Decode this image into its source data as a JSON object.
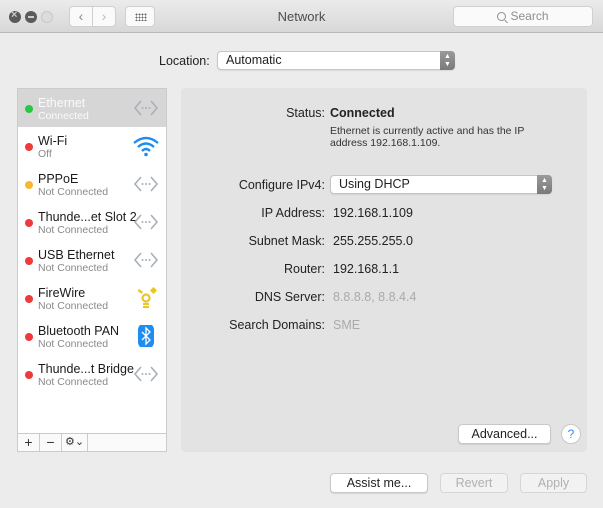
{
  "window": {
    "title": "Network",
    "search_placeholder": "Search",
    "back_glyph": "‹",
    "forward_glyph": "›"
  },
  "location": {
    "label": "Location:",
    "value": "Automatic"
  },
  "services": [
    {
      "name": "Ethernet",
      "status": "Connected",
      "dot_color": "#28c840",
      "icon": "ethernet-icon",
      "selected": true
    },
    {
      "name": "Wi-Fi",
      "status": "Off",
      "dot_color": "#f0393c",
      "icon": "wifi-icon"
    },
    {
      "name": "PPPoE",
      "status": "Not Connected",
      "dot_color": "#f8b82e",
      "icon": "ethernet-icon"
    },
    {
      "name": "Thunde...et Slot 2",
      "status": "Not Connected",
      "dot_color": "#f0393c",
      "icon": "ethernet-icon"
    },
    {
      "name": "USB Ethernet",
      "status": "Not Connected",
      "dot_color": "#f0393c",
      "icon": "ethernet-icon"
    },
    {
      "name": "FireWire",
      "status": "Not Connected",
      "dot_color": "#f0393c",
      "icon": "firewire-icon"
    },
    {
      "name": "Bluetooth PAN",
      "status": "Not Connected",
      "dot_color": "#f0393c",
      "icon": "bluetooth-icon"
    },
    {
      "name": "Thunde...t Bridge",
      "status": "Not Connected",
      "dot_color": "#f0393c",
      "icon": "ethernet-icon"
    }
  ],
  "sidebar_controls": {
    "add": "+",
    "remove": "−",
    "gear": "⚙⌄"
  },
  "detail": {
    "status_label": "Status:",
    "status_value": "Connected",
    "status_description": "Ethernet is currently active and has the IP address 192.168.1.109.",
    "configure_label": "Configure IPv4:",
    "configure_value": "Using DHCP",
    "ip_label": "IP Address:",
    "ip_value": "192.168.1.109",
    "subnet_label": "Subnet Mask:",
    "subnet_value": "255.255.255.0",
    "router_label": "Router:",
    "router_value": "192.168.1.1",
    "dns_label": "DNS Server:",
    "dns_value": "8.8.8.8, 8.8.4.4",
    "domains_label": "Search Domains:",
    "domains_value": "SME",
    "advanced_button": "Advanced...",
    "help_button": "?"
  },
  "footer": {
    "assist_button": "Assist me...",
    "revert_button": "Revert",
    "apply_button": "Apply"
  }
}
